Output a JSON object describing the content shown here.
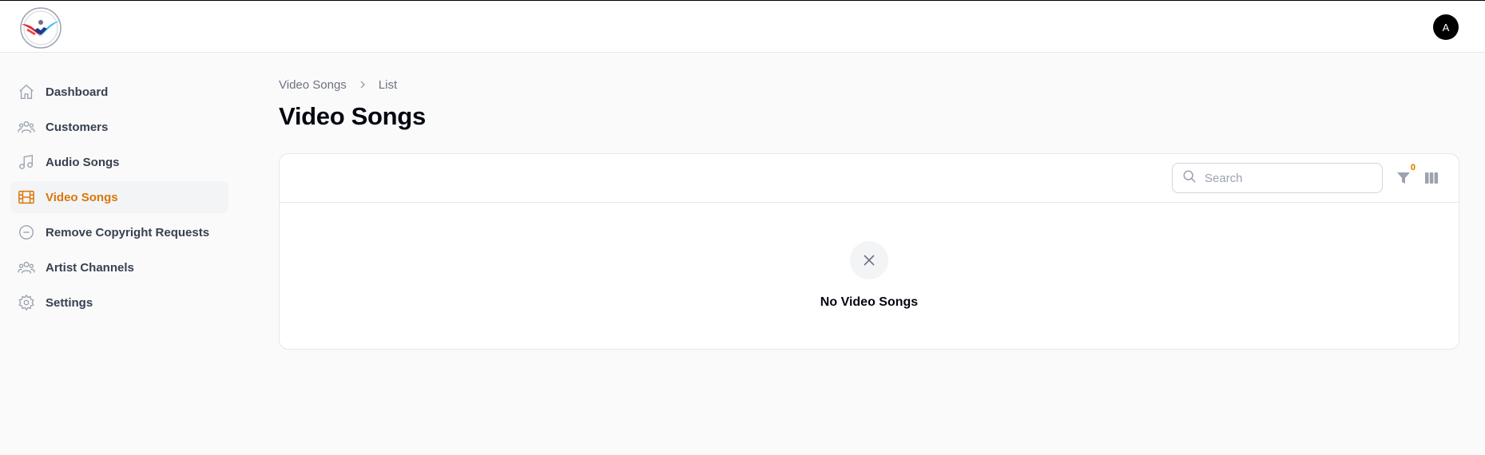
{
  "header": {
    "logo_name": "first-call-logo",
    "avatar_initial": "A"
  },
  "sidebar": {
    "items": [
      {
        "label": "Dashboard",
        "icon": "home-icon",
        "active": false
      },
      {
        "label": "Customers",
        "icon": "users-icon",
        "active": false
      },
      {
        "label": "Audio Songs",
        "icon": "music-note-icon",
        "active": false
      },
      {
        "label": "Video Songs",
        "icon": "film-icon",
        "active": true
      },
      {
        "label": "Remove Copyright Requests",
        "icon": "minus-circle-icon",
        "active": false
      },
      {
        "label": "Artist Channels",
        "icon": "users-icon",
        "active": false
      },
      {
        "label": "Settings",
        "icon": "gear-icon",
        "active": false
      }
    ]
  },
  "breadcrumb": {
    "items": [
      "Video Songs",
      "List"
    ]
  },
  "page": {
    "title": "Video Songs"
  },
  "table": {
    "search_placeholder": "Search",
    "search_value": "",
    "filter_count": "0",
    "empty_text": "No Video Songs"
  },
  "colors": {
    "accent": "#d97706",
    "background": "#fafafa",
    "text": "#374151"
  }
}
